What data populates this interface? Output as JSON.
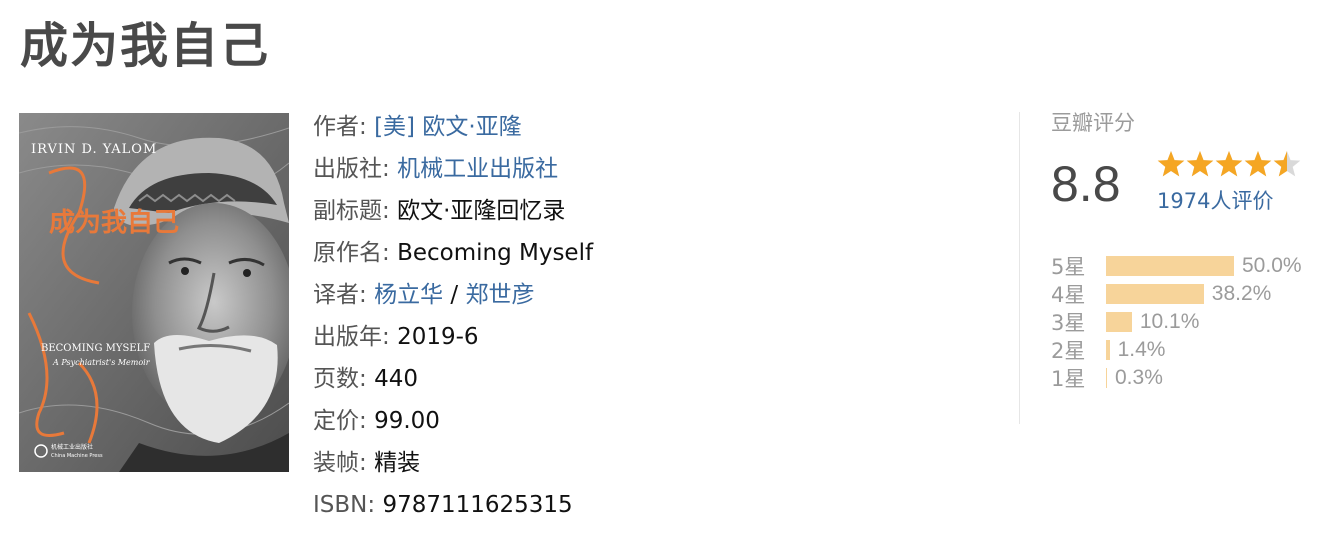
{
  "title": "成为我自己",
  "cover": {
    "author_en": "IRVIN D. YALOM",
    "title_cn": "成为我自己",
    "title_en": "BECOMING MYSELF",
    "subtitle_en": "A Psychiatrist's Memoir",
    "publisher_logo": "机械工业出版社",
    "publisher_en": "China Machine Press"
  },
  "info": {
    "author_label": "作者:",
    "author": "[美] 欧文·亚隆",
    "publisher_label": "出版社:",
    "publisher": "机械工业出版社",
    "subtitle_label": "副标题:",
    "subtitle": "欧文·亚隆回忆录",
    "original_label": "原作名:",
    "original": "Becoming Myself",
    "translator_label": "译者:",
    "translator_1": "杨立华",
    "translator_sep": "/",
    "translator_2": "郑世彦",
    "year_label": "出版年:",
    "year": "2019-6",
    "pages_label": "页数:",
    "pages": "440",
    "price_label": "定价:",
    "price": "99.00",
    "binding_label": "装帧:",
    "binding": "精装",
    "isbn_label": "ISBN:",
    "isbn": "9787111625315"
  },
  "rating": {
    "title": "豆瓣评分",
    "score": "8.8",
    "stars_value": 4.5,
    "count_text": "1974人评价",
    "star_color": "#f5a623",
    "bar_color": "#f7d49a",
    "distribution": [
      {
        "label": "5星",
        "percent": 50.0,
        "text": "50.0%"
      },
      {
        "label": "4星",
        "percent": 38.2,
        "text": "38.2%"
      },
      {
        "label": "3星",
        "percent": 10.1,
        "text": "10.1%"
      },
      {
        "label": "2星",
        "percent": 1.4,
        "text": "1.4%"
      },
      {
        "label": "1星",
        "percent": 0.3,
        "text": "0.3%"
      }
    ]
  }
}
